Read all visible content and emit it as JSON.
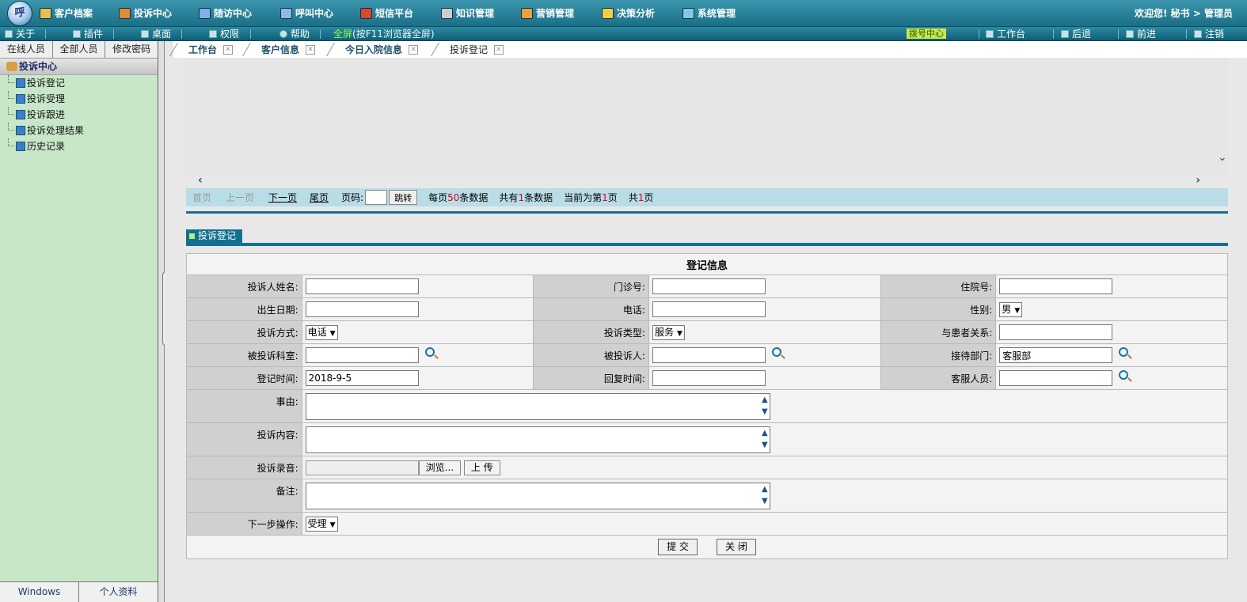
{
  "top_menu": [
    {
      "label": "客户档案",
      "icon": "customer-file-icon",
      "color": "#e8c050"
    },
    {
      "label": "投诉中心",
      "icon": "complaint-icon",
      "color": "#e08a3a"
    },
    {
      "label": "随访中心",
      "icon": "followup-icon",
      "color": "#7fb0e8"
    },
    {
      "label": "呼叫中心",
      "icon": "call-icon",
      "color": "#8fb7e8"
    },
    {
      "label": "短信平台",
      "icon": "sms-icon",
      "color": "#d84a2a"
    },
    {
      "label": "知识管理",
      "icon": "knowledge-icon",
      "color": "#cccccc"
    },
    {
      "label": "营销管理",
      "icon": "marketing-icon",
      "color": "#e8a040"
    },
    {
      "label": "决策分析",
      "icon": "decision-icon",
      "color": "#f0d040"
    },
    {
      "label": "系统管理",
      "icon": "system-icon",
      "color": "#7fc9e8"
    }
  ],
  "welcome": "欢迎您!  秘书 > 管理员",
  "toolbar": {
    "about": "关于",
    "plugin": "插件",
    "desktop": "桌面",
    "permission": "权限",
    "help": "帮助",
    "fullscreen_key": "全屏",
    "fullscreen_hint": "(按F11浏览器全屏)",
    "dial_center": "拨号中心",
    "workbench": "工作台",
    "back": "后退",
    "forward": "前进",
    "logout": "注销"
  },
  "sidebar": {
    "tabs": [
      "在线人员",
      "全部人员",
      "修改密码"
    ],
    "root": "投诉中心",
    "items": [
      "投诉登记",
      "投诉受理",
      "投诉跟进",
      "投诉处理结果",
      "历史记录"
    ],
    "bottom": [
      "Windows",
      "个人资料"
    ]
  },
  "tabs": [
    "工作台",
    "客户信息",
    "今日入院信息",
    "投诉登记"
  ],
  "pager": {
    "first": "首页",
    "prev": "上一页",
    "next": "下一页",
    "last": "尾页",
    "page_label": "页码:",
    "jump": "跳转",
    "per_page_pre": "每页",
    "per_page": "50",
    "per_page_post": "条数据",
    "total_pre": "共有",
    "total": "1",
    "total_post": "条数据",
    "current_pre": "当前为第",
    "current": "1",
    "current_post": "页",
    "pages_pre": "共",
    "pages": "1",
    "pages_post": "页"
  },
  "section_title": "投诉登记",
  "form": {
    "title": "登记信息",
    "complainant_name": "投诉人姓名:",
    "outpatient_no": "门诊号:",
    "inpatient_no": "住院号:",
    "birth_date": "出生日期:",
    "phone": "电话:",
    "gender": "性别:",
    "gender_value": "男",
    "method": "投诉方式:",
    "method_value": "电话",
    "type": "投诉类型:",
    "type_value": "服务",
    "relation": "与患者关系:",
    "dept": "被投诉科室:",
    "person": "被投诉人:",
    "reception": "接待部门:",
    "reception_value": "客服部",
    "reg_time": "登记时间:",
    "reg_time_value": "2018-9-5",
    "reply_time": "回复时间:",
    "staff": "客服人员:",
    "reason": "事由:",
    "content": "投诉内容:",
    "recording": "投诉录音:",
    "browse": "浏览...",
    "upload": "上 传",
    "remark": "备注:",
    "next_step": "下一步操作:",
    "next_step_value": "受理",
    "submit": "提 交",
    "close": "关 闭"
  }
}
